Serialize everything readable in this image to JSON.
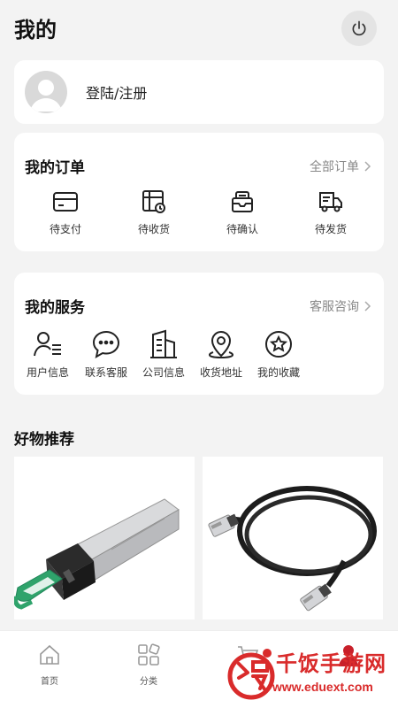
{
  "header": {
    "title": "我的"
  },
  "login": {
    "label": "登陆/注册"
  },
  "orders": {
    "title": "我的订单",
    "link": "全部订单",
    "items": [
      {
        "icon": "card-icon",
        "label": "待支付"
      },
      {
        "icon": "receive-icon",
        "label": "待收货"
      },
      {
        "icon": "confirm-icon",
        "label": "待确认"
      },
      {
        "icon": "truck-icon",
        "label": "待发货"
      }
    ]
  },
  "services": {
    "title": "我的服务",
    "link": "客服咨询",
    "items": [
      {
        "icon": "user-list-icon",
        "label": "用户信息"
      },
      {
        "icon": "chat-icon",
        "label": "联系客服"
      },
      {
        "icon": "building-icon",
        "label": "公司信息"
      },
      {
        "icon": "location-icon",
        "label": "收货地址"
      },
      {
        "icon": "star-icon",
        "label": "我的收藏"
      }
    ]
  },
  "recommend": {
    "title": "好物推荐"
  },
  "tabbar": {
    "items": [
      {
        "icon": "home-icon",
        "label": "首页"
      },
      {
        "icon": "category-icon",
        "label": "分类"
      },
      {
        "icon": "cart-icon",
        "label": ""
      },
      {
        "icon": "profile-icon",
        "label": ""
      }
    ]
  },
  "watermark": {
    "line1": "千饭手游网",
    "line2": "www.eduext.com"
  },
  "colors": {
    "background": "#f3f3f3",
    "accent_green": "#2fa36b",
    "watermark_red": "#d92b2b"
  }
}
